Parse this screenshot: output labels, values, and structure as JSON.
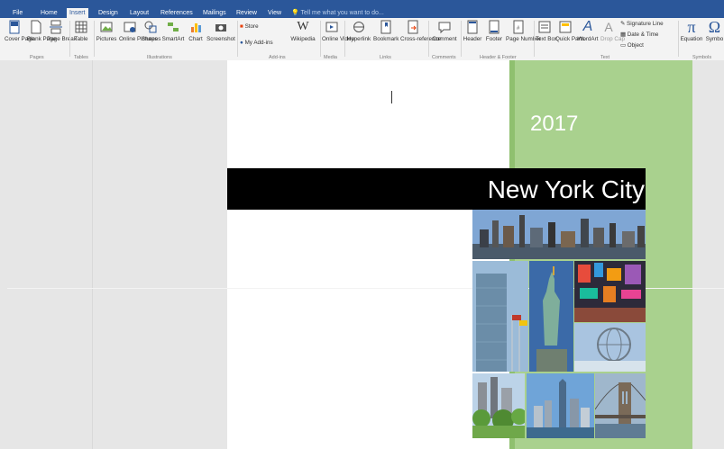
{
  "tabs": [
    "File",
    "Home",
    "Insert",
    "Design",
    "Layout",
    "References",
    "Mailings",
    "Review",
    "View"
  ],
  "active_tab": "Insert",
  "tell_me": "Tell me what you want to do...",
  "ribbon": {
    "cover_page": "Cover Page",
    "blank_page": "Blank Page",
    "page_break": "Page Break",
    "table": "Table",
    "pictures": "Pictures",
    "online_pictures": "Online Pictures",
    "shapes": "Shapes",
    "smartart": "SmartArt",
    "chart": "Chart",
    "screenshot": "Screenshot",
    "store": "Store",
    "my_addins": "My Add-ins",
    "wikipedia": "Wikipedia",
    "online_video": "Online Video",
    "hyperlink": "Hyperlink",
    "bookmark": "Bookmark",
    "cross_reference": "Cross-reference",
    "comment": "Comment",
    "header": "Header",
    "footer": "Footer",
    "page_number": "Page Number",
    "text_box": "Text Box",
    "quick_parts": "Quick Parts",
    "wordart": "WordArt",
    "drop_cap": "Drop Cap",
    "signature_line": "Signature Line",
    "date_time": "Date & Time",
    "object": "Object",
    "equation": "Equation",
    "symbol": "Symbo"
  },
  "groups": [
    "Pages",
    "Tables",
    "Illustrations",
    "Add-ins",
    "Media",
    "Links",
    "Comments",
    "Header & Footer",
    "Text",
    "Symbols"
  ],
  "document": {
    "year": "2017",
    "city": "New York City"
  }
}
